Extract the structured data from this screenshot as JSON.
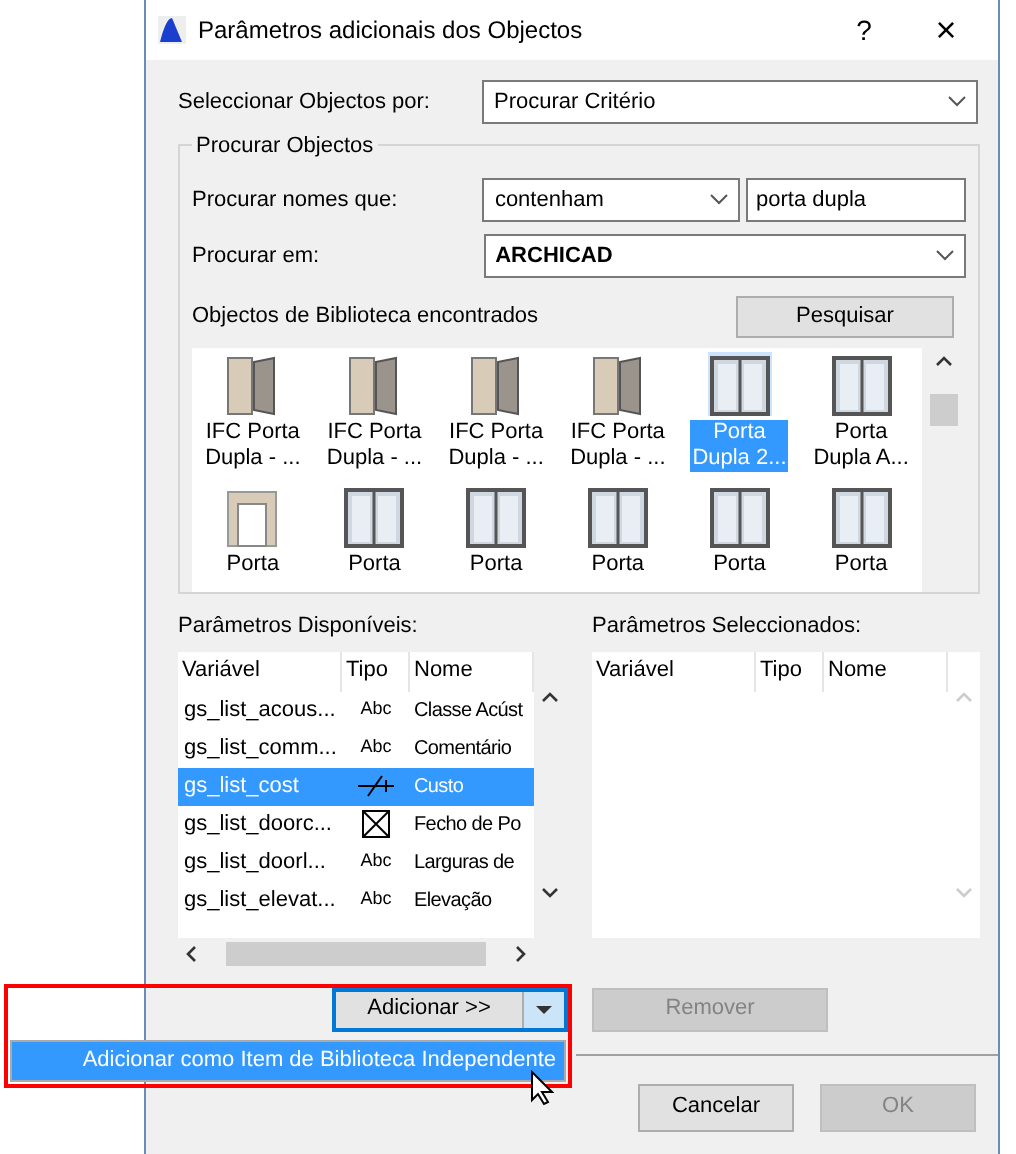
{
  "window": {
    "title": "Parâmetros adicionais dos Objectos",
    "help": "?",
    "close": "×"
  },
  "select_by": {
    "label": "Seleccionar Objectos por:",
    "value": "Procurar Critério"
  },
  "search_group": {
    "title": "Procurar Objectos",
    "names_label": "Procurar nomes que:",
    "names_mode": "contenham",
    "names_value": "porta dupla",
    "in_label": "Procurar em:",
    "in_value": "ARCHICAD",
    "found_label": "Objectos de Biblioteca encontrados",
    "search_button": "Pesquisar",
    "objects": [
      {
        "line1": "IFC Porta",
        "line2": "Dupla - ...",
        "kind": "wood",
        "selected": false
      },
      {
        "line1": "IFC Porta",
        "line2": "Dupla - ...",
        "kind": "wood",
        "selected": false
      },
      {
        "line1": "IFC Porta",
        "line2": "Dupla - ...",
        "kind": "wood",
        "selected": false
      },
      {
        "line1": "IFC Porta",
        "line2": "Dupla - ...",
        "kind": "wood",
        "selected": false
      },
      {
        "line1": "Porta",
        "line2": "Dupla 2...",
        "kind": "glass",
        "selected": true
      },
      {
        "line1": "Porta",
        "line2": "Dupla A...",
        "kind": "glass",
        "selected": false
      },
      {
        "line1": "Porta",
        "kind": "frame",
        "selected": false
      },
      {
        "line1": "Porta",
        "kind": "glass",
        "selected": false
      },
      {
        "line1": "Porta",
        "kind": "glass",
        "selected": false
      },
      {
        "line1": "Porta",
        "kind": "glass",
        "selected": false
      },
      {
        "line1": "Porta",
        "kind": "glass",
        "selected": false
      },
      {
        "line1": "Porta",
        "kind": "glass",
        "selected": false
      }
    ]
  },
  "available": {
    "label": "Parâmetros Disponíveis:",
    "columns": [
      "Variável",
      "Tipo",
      "Nome"
    ],
    "rows": [
      {
        "variable": "gs_list_acous...",
        "type": {
          "kind": "text",
          "label": "Abc"
        },
        "name": "Classe Acúst",
        "selected": false
      },
      {
        "variable": "gs_list_comm...",
        "type": {
          "kind": "text",
          "label": "Abc"
        },
        "name": "Comentário",
        "selected": false
      },
      {
        "variable": "gs_list_cost",
        "type": {
          "kind": "real"
        },
        "name": "Custo",
        "selected": true
      },
      {
        "variable": "gs_list_doorc...",
        "type": {
          "kind": "boolean"
        },
        "name": "Fecho de Po",
        "selected": false
      },
      {
        "variable": "gs_list_doorl...",
        "type": {
          "kind": "text",
          "label": "Abc"
        },
        "name": "Larguras de",
        "selected": false
      },
      {
        "variable": "gs_list_elevat...",
        "type": {
          "kind": "text",
          "label": "Abc"
        },
        "name": "Elevação",
        "selected": false
      }
    ]
  },
  "selected_params": {
    "label": "Parâmetros Seleccionados:",
    "columns": [
      "Variável",
      "Tipo",
      "Nome"
    ]
  },
  "add_button": {
    "label": "Adicionar >>",
    "menu_open": true
  },
  "add_menu": [
    {
      "label": "Adicionar como Item de Biblioteca Independente",
      "selected": true
    }
  ],
  "remove_button": {
    "label": "Remover",
    "disabled": true
  },
  "buttons": [
    {
      "label": "Cancelar",
      "disabled": false
    },
    {
      "label": "OK",
      "disabled": true
    }
  ]
}
